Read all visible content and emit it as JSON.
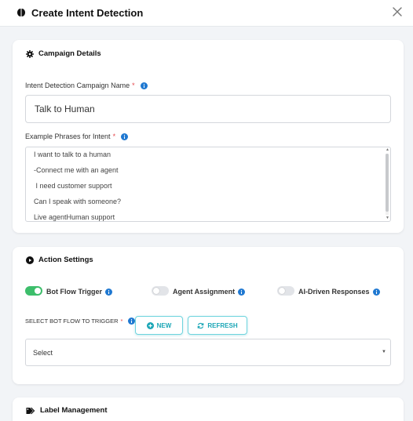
{
  "header": {
    "title": "Create Intent Detection",
    "brain_icon": "brain-icon",
    "close_icon": "close-icon"
  },
  "campaign": {
    "title": "Campaign Details",
    "name_label": "Intent Detection Campaign Name",
    "name_value": "Talk to Human",
    "phrases_label": "Example Phrases for Intent",
    "phrases": [
      "I want to talk to a human",
      "-Connect me with an agent",
      " I need customer support",
      "Can I speak with someone?",
      "Live agentHuman support"
    ]
  },
  "action": {
    "title": "Action Settings",
    "toggles": [
      {
        "label": "Bot Flow Trigger",
        "on": true
      },
      {
        "label": "Agent Assignment",
        "on": false
      },
      {
        "label": "AI-Driven Responses",
        "on": false
      }
    ],
    "select_label": "SELECT BOT FLOW TO TRIGGER",
    "new_label": "NEW",
    "refresh_label": "REFRESH",
    "select_value": "Select"
  },
  "label_mgmt": {
    "title": "Label Management"
  },
  "required_mark": "*",
  "colors": {
    "accent": "#1ba6b6",
    "toggle_on": "#3dbe6b",
    "info": "#1f78d1",
    "required": "#e5484d"
  }
}
